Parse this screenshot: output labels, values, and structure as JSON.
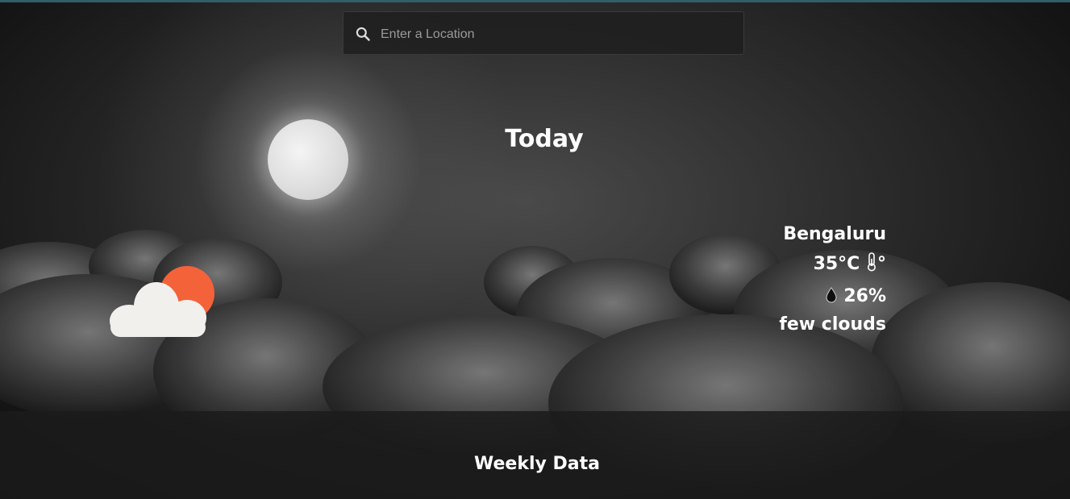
{
  "search": {
    "placeholder": "Enter a Location",
    "value": ""
  },
  "today": {
    "heading": "Today",
    "condition_icon": "partly-cloudy-day-icon"
  },
  "current": {
    "city": "Bengaluru",
    "temperature": "35°C",
    "temperature_icon": "thermometer-icon",
    "degree_mark": "°",
    "humidity": "26%",
    "humidity_icon": "droplet-icon",
    "description": "few clouds"
  },
  "weekly": {
    "heading": "Weekly Data"
  },
  "colors": {
    "sun": "#f4623a",
    "cloud": "#f2f0ed",
    "text": "#ffffff",
    "top_bar": "#2f5f6a"
  }
}
